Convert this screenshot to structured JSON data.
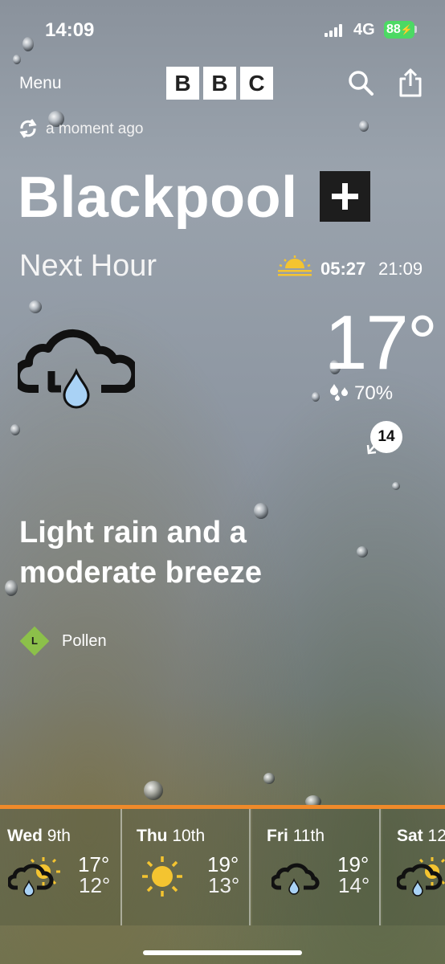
{
  "status_bar": {
    "time": "14:09",
    "network": "4G",
    "battery": "88"
  },
  "header": {
    "menu_label": "Menu",
    "logo_letters": [
      "B",
      "B",
      "C"
    ],
    "search_icon": "search-icon",
    "share_icon": "share-icon"
  },
  "refresh": {
    "icon": "refresh-icon",
    "text": "a moment ago"
  },
  "location": {
    "name": "Blackpool",
    "add_icon": "plus-icon"
  },
  "now": {
    "period": "Next Hour",
    "sunrise": "05:27",
    "sunset": "21:09",
    "weather_icon": "light-rain-cloud-icon",
    "temperature": "17°",
    "rain_chance": "70%",
    "wind_speed": "14",
    "summary": "Light rain and a moderate breeze"
  },
  "pollen": {
    "level_letter": "L",
    "label": "Pollen",
    "color": "#8cc04a"
  },
  "forecast": [
    {
      "day": "Wed",
      "date": "9th",
      "icon": "sun-cloud-rain-icon",
      "high": "17°",
      "low": "12°"
    },
    {
      "day": "Thu",
      "date": "10th",
      "icon": "sun-icon",
      "high": "19°",
      "low": "13°"
    },
    {
      "day": "Fri",
      "date": "11th",
      "icon": "light-rain-cloud-icon",
      "high": "19°",
      "low": "14°"
    },
    {
      "day": "Sat",
      "date": "12",
      "icon": "sun-cloud-rain-icon",
      "high": "",
      "low": ""
    }
  ],
  "colors": {
    "accent_orange": "#ef8a2a",
    "battery_green": "#4cd964",
    "raindrop_blue": "#a9d2f5"
  }
}
